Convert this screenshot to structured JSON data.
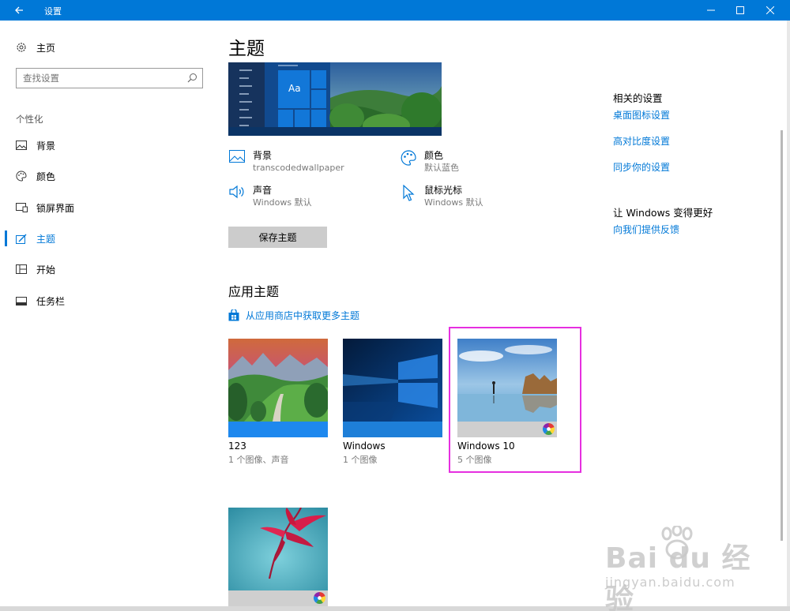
{
  "window": {
    "title": "设置"
  },
  "nav": {
    "home_label": "主页",
    "search_placeholder": "查找设置",
    "group_label": "个性化",
    "items": [
      {
        "label": "背景",
        "icon": "picture-icon"
      },
      {
        "label": "颜色",
        "icon": "palette-icon"
      },
      {
        "label": "锁屏界面",
        "icon": "lock-screen-icon"
      },
      {
        "label": "主题",
        "icon": "theme-brush-icon",
        "active": true
      },
      {
        "label": "开始",
        "icon": "start-tiles-icon"
      },
      {
        "label": "任务栏",
        "icon": "taskbar-icon"
      }
    ]
  },
  "main": {
    "title": "主题",
    "preview_tile_text": "Aa",
    "props": [
      {
        "title": "背景",
        "value": "transcodedwallpaper",
        "icon": "picture-icon"
      },
      {
        "title": "颜色",
        "value": "默认蓝色",
        "icon": "palette-icon"
      },
      {
        "title": "声音",
        "value": "Windows 默认",
        "icon": "speaker-icon"
      },
      {
        "title": "鼠标光标",
        "value": "Windows 默认",
        "icon": "cursor-icon"
      }
    ],
    "save_button": "保存主题",
    "apply_title": "应用主题",
    "store_link": "从应用商店中获取更多主题",
    "themes": [
      {
        "name": "123",
        "desc": "1 个图像、声音",
        "accent": "#1e88ee"
      },
      {
        "name": "Windows",
        "desc": "1 个图像",
        "accent": "#1e7fd8"
      },
      {
        "name": "Windows 10",
        "desc": "5 个图像",
        "accent": "#cfcfcf"
      },
      {
        "name": "",
        "desc": "",
        "accent": "#cfcfcf"
      }
    ]
  },
  "related": {
    "heading": "相关的设置",
    "links": [
      "桌面图标设置",
      "高对比度设置",
      "同步你的设置"
    ],
    "improve_heading": "让 Windows 变得更好",
    "feedback_link": "向我们提供反馈"
  },
  "watermark": {
    "main": "Bai du 经验",
    "sub": "jingyan.baidu.com"
  },
  "colors": {
    "accent": "#0078d7",
    "highlight": "#e62fe0"
  }
}
